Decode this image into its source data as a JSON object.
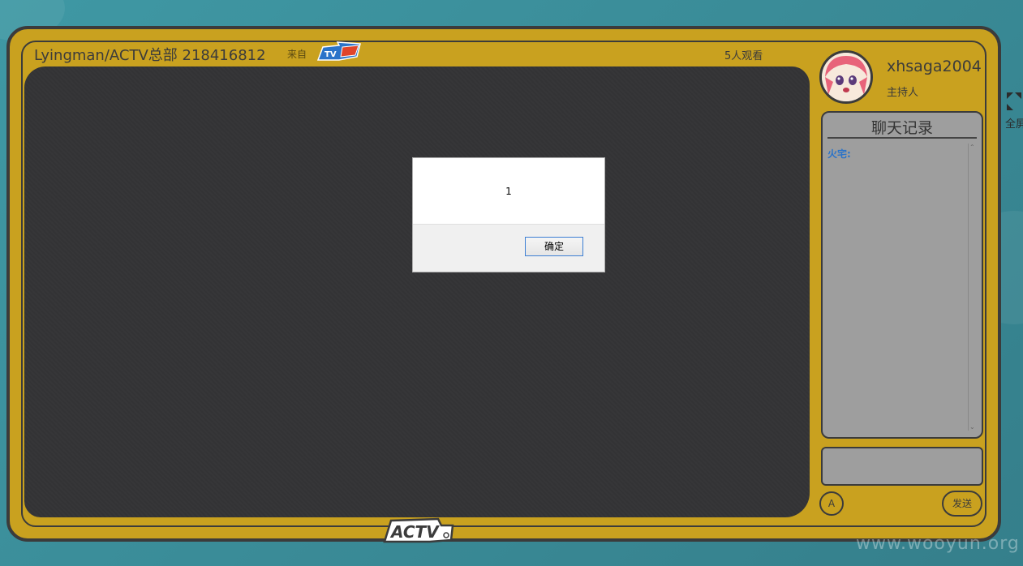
{
  "header": {
    "room_title": "Lyingman/ACTV总部 218416812",
    "from_label": "来自",
    "brand_logo_icon": "zhanqi-tv-logo",
    "viewers": "5人观看"
  },
  "host": {
    "avatar_icon": "anime-girl-avatar",
    "name": "xhsaga2004",
    "role": "主持人"
  },
  "chat": {
    "title": "聊天记录",
    "messages": [
      {
        "user": "火宅:",
        "text": ""
      }
    ],
    "input_value": "",
    "a_button_label": "A",
    "send_label": "发送"
  },
  "side": {
    "fullscreen_label": "全屏"
  },
  "dialog": {
    "message": "1",
    "ok_label": "确定"
  },
  "footer": {
    "logo_icon": "actv-logo",
    "watermark": "www.wooyun.org"
  },
  "colors": {
    "background": "#3a8f9c",
    "frame": "#c9a11f",
    "screen": "#333335",
    "chat_panel": "#9e9e9e",
    "chat_user": "#2a73c9"
  }
}
